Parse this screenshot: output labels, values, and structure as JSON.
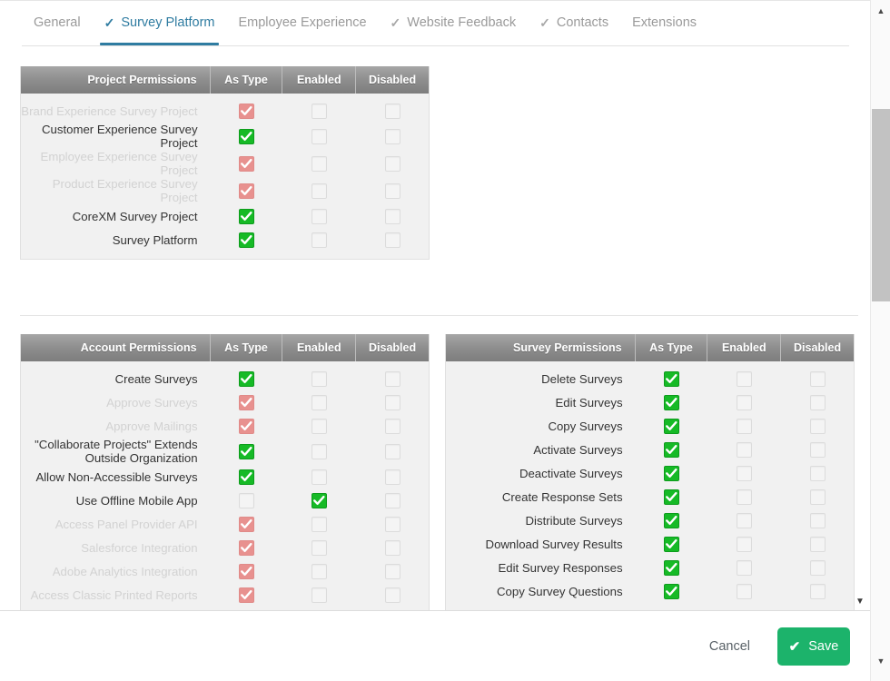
{
  "tabs": [
    {
      "label": "General",
      "check": "",
      "active": false
    },
    {
      "label": "Survey Platform",
      "check": "✓",
      "active": true
    },
    {
      "label": "Employee Experience",
      "check": "",
      "active": false
    },
    {
      "label": "Website Feedback",
      "check": "✓",
      "active": false
    },
    {
      "label": "Contacts",
      "check": "✓",
      "active": false
    },
    {
      "label": "Extensions",
      "check": "",
      "active": false
    }
  ],
  "tab_checks_note": "checkmark precedes Survey Platform, Website Feedback, Contacts",
  "columns": {
    "as_type": "As Type",
    "enabled": "Enabled",
    "disabled": "Disabled"
  },
  "tables": [
    {
      "id": "project-permissions",
      "title": "Project Permissions",
      "rows": [
        {
          "label": "Brand Experience Survey Project",
          "muted": true,
          "as_type": "red",
          "enabled": "empty",
          "disabled": "empty"
        },
        {
          "label": "Customer Experience Survey Project",
          "muted": false,
          "as_type": "green",
          "enabled": "empty",
          "disabled": "empty"
        },
        {
          "label": "Employee Experience Survey Project",
          "muted": true,
          "as_type": "red",
          "enabled": "empty",
          "disabled": "empty"
        },
        {
          "label": "Product Experience Survey Project",
          "muted": true,
          "as_type": "red",
          "enabled": "empty",
          "disabled": "empty"
        },
        {
          "label": "CoreXM Survey Project",
          "muted": false,
          "as_type": "green",
          "enabled": "empty",
          "disabled": "empty"
        },
        {
          "label": "Survey Platform",
          "muted": false,
          "as_type": "green",
          "enabled": "empty",
          "disabled": "empty"
        }
      ]
    },
    {
      "id": "account-permissions",
      "title": "Account Permissions",
      "rows": [
        {
          "label": "Create Surveys",
          "muted": false,
          "as_type": "green",
          "enabled": "empty",
          "disabled": "empty"
        },
        {
          "label": "Approve Surveys",
          "muted": true,
          "as_type": "red",
          "enabled": "empty",
          "disabled": "empty"
        },
        {
          "label": "Approve Mailings",
          "muted": true,
          "as_type": "red",
          "enabled": "empty",
          "disabled": "empty"
        },
        {
          "label": "\"Collaborate Projects\" Extends Outside Organization",
          "muted": false,
          "as_type": "green",
          "enabled": "empty",
          "disabled": "empty"
        },
        {
          "label": "Allow Non-Accessible Surveys",
          "muted": false,
          "as_type": "green",
          "enabled": "empty",
          "disabled": "empty"
        },
        {
          "label": "Use Offline Mobile App",
          "muted": false,
          "as_type": "empty",
          "enabled": "green",
          "disabled": "empty"
        },
        {
          "label": "Access Panel Provider API",
          "muted": true,
          "as_type": "red",
          "enabled": "empty",
          "disabled": "empty"
        },
        {
          "label": "Salesforce Integration",
          "muted": true,
          "as_type": "red",
          "enabled": "empty",
          "disabled": "empty"
        },
        {
          "label": "Adobe Analytics Integration",
          "muted": true,
          "as_type": "red",
          "enabled": "empty",
          "disabled": "empty"
        },
        {
          "label": "Access Classic Printed Reports",
          "muted": true,
          "as_type": "red",
          "enabled": "empty",
          "disabled": "empty"
        }
      ]
    },
    {
      "id": "survey-permissions",
      "title": "Survey Permissions",
      "rows": [
        {
          "label": "Delete Surveys",
          "muted": false,
          "as_type": "green",
          "enabled": "empty",
          "disabled": "empty"
        },
        {
          "label": "Edit Surveys",
          "muted": false,
          "as_type": "green",
          "enabled": "empty",
          "disabled": "empty"
        },
        {
          "label": "Copy Surveys",
          "muted": false,
          "as_type": "green",
          "enabled": "empty",
          "disabled": "empty"
        },
        {
          "label": "Activate Surveys",
          "muted": false,
          "as_type": "green",
          "enabled": "empty",
          "disabled": "empty"
        },
        {
          "label": "Deactivate Surveys",
          "muted": false,
          "as_type": "green",
          "enabled": "empty",
          "disabled": "empty"
        },
        {
          "label": "Create Response Sets",
          "muted": false,
          "as_type": "green",
          "enabled": "empty",
          "disabled": "empty"
        },
        {
          "label": "Distribute Surveys",
          "muted": false,
          "as_type": "green",
          "enabled": "empty",
          "disabled": "empty"
        },
        {
          "label": "Download Survey Results",
          "muted": false,
          "as_type": "green",
          "enabled": "empty",
          "disabled": "empty"
        },
        {
          "label": "Edit Survey Responses",
          "muted": false,
          "as_type": "green",
          "enabled": "empty",
          "disabled": "empty"
        },
        {
          "label": "Copy Survey Questions",
          "muted": false,
          "as_type": "green",
          "enabled": "empty",
          "disabled": "empty"
        }
      ]
    }
  ],
  "footer": {
    "cancel_label": "Cancel",
    "save_label": "Save",
    "save_check": "✔"
  },
  "colors": {
    "accent_blue": "#2f7ca1",
    "save_green": "#1cb36b",
    "checkbox_green": "#16ba26",
    "checkbox_red": "#e8918f",
    "header_gray": "#8e8e8e",
    "muted_text": "#d2d2d2"
  },
  "scrollbar": {
    "up_arrow": "▲",
    "down_arrow": "▼"
  }
}
